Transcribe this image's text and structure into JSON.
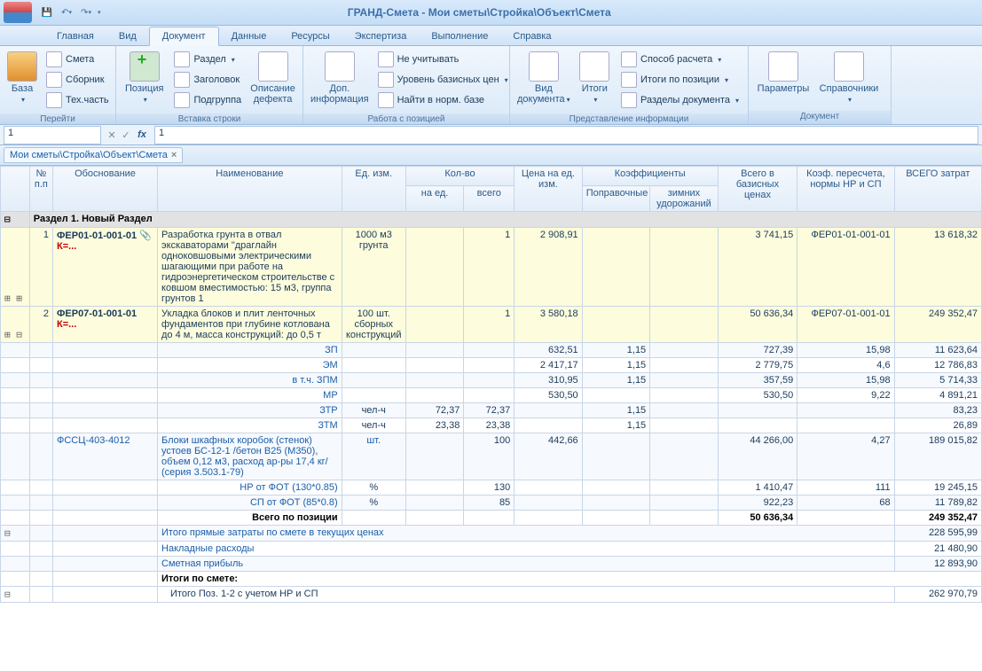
{
  "title": "ГРАНД-Смета - Мои сметы\\Стройка\\Объект\\Смета",
  "tabs": [
    "Главная",
    "Вид",
    "Документ",
    "Данные",
    "Ресурсы",
    "Экспертиза",
    "Выполнение",
    "Справка"
  ],
  "ribbon": {
    "g1": {
      "label": "Перейти",
      "big": "База",
      "s": [
        "Смета",
        "Сборник",
        "Тех.часть"
      ]
    },
    "g2": {
      "label": "Вставка строки",
      "big": "Позиция",
      "s": [
        "Раздел",
        "Заголовок",
        "Подгруппа"
      ],
      "def": "Описание\nдефекта"
    },
    "g3": {
      "label": "Работа с позицией",
      "big": "Доп.\nинформация",
      "s": [
        "Не учитывать",
        "Уровень базисных цен",
        "Найти в норм. базе"
      ]
    },
    "g4": {
      "label": "Представление информации",
      "big1": "Вид\nдокумента",
      "big2": "Итоги",
      "s": [
        "Способ расчета",
        "Итоги по позиции",
        "Разделы документа"
      ]
    },
    "g5": {
      "label": "Документ",
      "big1": "Параметры",
      "big2": "Справочники"
    }
  },
  "formula": {
    "cell": "1",
    "value": "1"
  },
  "path": "Мои сметы\\Стройка\\Объект\\Смета",
  "headers": {
    "np": "№ п.п",
    "obo": "Обоснование",
    "name": "Наименование",
    "ed": "Ед. изм.",
    "kolvo": "Кол-во",
    "naed": "на ед.",
    "vsego": "всего",
    "cena": "Цена на ед. изм.",
    "koef": "Коэффициенты",
    "popr": "Поправочные",
    "zim": "зимних удорожаний",
    "vseb": "Всего в базисных ценах",
    "kp": "Коэф. пересчета, нормы НР и СП",
    "vsez": "ВСЕГО затрат"
  },
  "section": "Раздел 1. Новый Раздел",
  "rows": [
    {
      "n": "1",
      "code": "ФЕР01-01-001-01",
      "k": "К=...",
      "name": "Разработка грунта в отвал экскаваторами \"драглайн одноковшовыми электрическими шагающими при работе на гидроэнергетическом строительстве с ковшом вместимостью: 15 м3, группа грунтов 1",
      "ed": "1000 м3 грунта",
      "kv": "1",
      "cena": "2 908,91",
      "vsb": "3 741,15",
      "kp": "ФЕР01-01-001-01",
      "vsz": "13 618,32"
    },
    {
      "n": "2",
      "code": "ФЕР07-01-001-01",
      "k": "К=...",
      "name": "Укладка блоков и плит ленточных фундаментов при глубине котлована до 4 м, масса конструкций: до 0,5 т",
      "ed": "100 шт. сборных конструкций",
      "kv": "1",
      "cena": "3 580,18",
      "vsb": "50 636,34",
      "kp": "ФЕР07-01-001-01",
      "vsz": "249 352,47"
    }
  ],
  "sub": [
    {
      "name": "ЗП",
      "cena": "632,51",
      "kf": "1,15",
      "vsb": "727,39",
      "kp": "15,98",
      "vsz": "11 623,64"
    },
    {
      "name": "ЭМ",
      "cena": "2 417,17",
      "kf": "1,15",
      "vsb": "2 779,75",
      "kp": "4,6",
      "vsz": "12 786,83"
    },
    {
      "name": "в т.ч. ЗПМ",
      "cena": "310,95",
      "kf": "1,15",
      "vsb": "357,59",
      "kp": "15,98",
      "vsz": "5 714,33"
    },
    {
      "name": "МР",
      "cena": "530,50",
      "vsb": "530,50",
      "kp": "9,22",
      "vsz": "4 891,21"
    },
    {
      "name": "ЗТР",
      "ed": "чел-ч",
      "naed": "72,37",
      "vsego": "72,37",
      "kf": "1,15",
      "vsz": "83,23"
    },
    {
      "name": "ЗТМ",
      "ed": "чел-ч",
      "naed": "23,38",
      "vsego": "23,38",
      "kf": "1,15",
      "vsz": "26,89"
    }
  ],
  "res": {
    "code": "ФССЦ-403-4012",
    "name": "Блоки шкафных коробок (стенок) устоев БС-12-1 /бетон В25 (М350), объем 0,12 м3, расход ар-ры 17,4 кг/ (серия 3.503.1-79)",
    "ed": "шт.",
    "vsego": "100",
    "cena": "442,66",
    "vsb": "44 266,00",
    "kp": "4,27",
    "vsz": "189 015,82"
  },
  "nr": {
    "name": "НР от ФОТ (130*0.85)",
    "ed": "%",
    "vsego": "130",
    "vsb": "1 410,47",
    "kp": "111",
    "vsz": "19 245,15"
  },
  "sp": {
    "name": "СП от ФОТ (85*0.8)",
    "ed": "%",
    "vsego": "85",
    "vsb": "922,23",
    "kp": "68",
    "vsz": "11 789,82"
  },
  "total": {
    "name": "Всего по позиции",
    "vsb": "50 636,34",
    "vsz": "249 352,47"
  },
  "foot": [
    {
      "name": "Итого прямые затраты по смете в текущих ценах",
      "v": "228 595,99"
    },
    {
      "name": "Накладные расходы",
      "v": "21 480,90"
    },
    {
      "name": "Сметная прибыль",
      "v": "12 893,90"
    }
  ],
  "itogi": {
    "header": "Итоги по смете:",
    "row": "Итого Поз. 1-2 с учетом НР и СП",
    "v": "262 970,79"
  }
}
